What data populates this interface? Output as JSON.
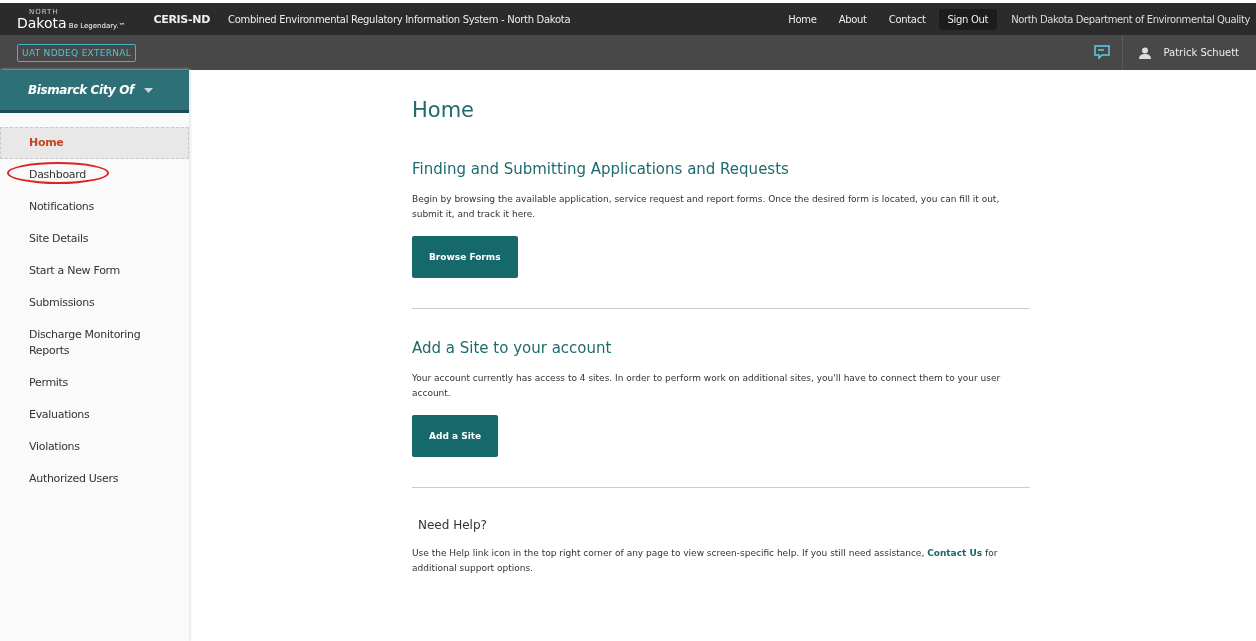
{
  "header": {
    "logo": {
      "small": "NORTH",
      "name": "Dakota",
      "tagline": "Be Legendary.™"
    },
    "app_name": "CERIS-ND",
    "app_title": "Combined Environmental Regulatory Information System - North Dakota",
    "nav": [
      {
        "label": "Home",
        "selected": false
      },
      {
        "label": "About",
        "selected": false
      },
      {
        "label": "Contact",
        "selected": false
      },
      {
        "label": "Sign Out",
        "selected": true
      }
    ],
    "agency": "North Dakota Department of Environmental Quality"
  },
  "subheader": {
    "environment": "UAT NDDEQ EXTERNAL",
    "user": "Patrick Schuett"
  },
  "sidebar": {
    "account": "Bismarck City Of",
    "items": [
      {
        "label": "Home",
        "selected": true,
        "circled": false
      },
      {
        "label": "Dashboard",
        "selected": false,
        "circled": true
      },
      {
        "label": "Notifications",
        "selected": false,
        "circled": false
      },
      {
        "label": "Site Details",
        "selected": false,
        "circled": false
      },
      {
        "label": "Start a New Form",
        "selected": false,
        "circled": false
      },
      {
        "label": "Submissions",
        "selected": false,
        "circled": false
      },
      {
        "label": "Discharge Monitoring Reports",
        "selected": false,
        "circled": false
      },
      {
        "label": "Permits",
        "selected": false,
        "circled": false
      },
      {
        "label": "Evaluations",
        "selected": false,
        "circled": false
      },
      {
        "label": "Violations",
        "selected": false,
        "circled": false
      },
      {
        "label": "Authorized Users",
        "selected": false,
        "circled": false
      }
    ]
  },
  "main": {
    "title": "Home",
    "sections": [
      {
        "heading": "Finding and Submitting Applications and Requests",
        "text": "Begin by browsing the available application, service request and report forms. Once the desired form is located, you can fill it out, submit it, and track it here.",
        "button": "Browse Forms"
      },
      {
        "heading": "Add a Site to your account",
        "text": "Your account currently has access to 4 sites. In order to perform work on additional sites, you'll have to connect them to your user account.",
        "button": "Add a Site"
      }
    ],
    "help": {
      "heading": "Need Help?",
      "text_before": "Use the Help link icon in the top right corner of any page to view screen-specific help. If you still need assistance, ",
      "link": "Contact Us",
      "text_after": " for additional support options."
    }
  }
}
